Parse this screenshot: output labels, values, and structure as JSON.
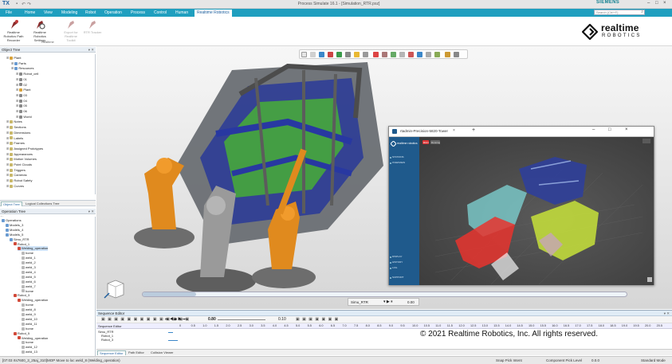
{
  "titlebar": {
    "logo": "TX",
    "app_title": "Process Simulate 16.1 - [Simulation_RTR.psz]",
    "brand": "SIEMENS",
    "win_controls": [
      "–",
      "□",
      "×"
    ]
  },
  "ribbon_tabs": [
    {
      "label": "File",
      "active": false
    },
    {
      "label": "Home",
      "active": false
    },
    {
      "label": "View",
      "active": false
    },
    {
      "label": "Modeling",
      "active": false
    },
    {
      "label": "Robot",
      "active": false
    },
    {
      "label": "Operation",
      "active": false
    },
    {
      "label": "Process",
      "active": false
    },
    {
      "label": "Control",
      "active": false
    },
    {
      "label": "Human",
      "active": false
    },
    {
      "label": "Realtime Robotics",
      "active": true
    }
  ],
  "search": {
    "placeholder": "Search (Ctrl+F)",
    "icon": "search-icon"
  },
  "ribbon": {
    "buttons": [
      {
        "label": "Realtime Robotics Path Recorder",
        "icon": "path-recorder-icon",
        "disabled": false
      },
      {
        "label": "Realtime Robotics Settings",
        "icon": "settings-icon",
        "disabled": false
      },
      {
        "label": "Export for Realtime Toolkit",
        "icon": "export-icon",
        "disabled": true
      },
      {
        "label": "RTR Tracker",
        "icon": "tracker-icon",
        "disabled": true
      }
    ],
    "group_label": "Realtime"
  },
  "brand_logo": {
    "line1": "realtime",
    "line2": "ROBOTICS"
  },
  "object_tree": {
    "title": "Object Tree",
    "column": "Name",
    "rows": [
      {
        "label": "Plant",
        "indent": 1,
        "color": "#d9a23a"
      },
      {
        "label": "Parts",
        "indent": 2,
        "color": "#6a9bd1"
      },
      {
        "label": "Resources",
        "indent": 2,
        "color": "#6a9bd1"
      },
      {
        "label": "Robot_cell",
        "indent": 3,
        "color": "#888888"
      },
      {
        "label": "01",
        "indent": 3,
        "color": "#888888"
      },
      {
        "label": "02",
        "indent": 3,
        "color": "#888888"
      },
      {
        "label": "Plant",
        "indent": 3,
        "color": "#d9a23a"
      },
      {
        "label": "03",
        "indent": 3,
        "color": "#888888"
      },
      {
        "label": "04",
        "indent": 3,
        "color": "#888888"
      },
      {
        "label": "05",
        "indent": 3,
        "color": "#888888"
      },
      {
        "label": "06",
        "indent": 3,
        "color": "#888888"
      },
      {
        "label": "World",
        "indent": 3,
        "color": "#888888"
      },
      {
        "label": "Notes",
        "indent": 1,
        "color": "#c9b86a"
      },
      {
        "label": "Sections",
        "indent": 1,
        "color": "#c9b86a"
      },
      {
        "label": "Dimensions",
        "indent": 1,
        "color": "#c9b86a"
      },
      {
        "label": "Labels",
        "indent": 1,
        "color": "#c9b86a"
      },
      {
        "label": "Frames",
        "indent": 1,
        "color": "#c9b86a"
      },
      {
        "label": "Assigned Prototypes",
        "indent": 1,
        "color": "#c9b86a"
      },
      {
        "label": "Appearances",
        "indent": 1,
        "color": "#c9b86a"
      },
      {
        "label": "Motion Volumes",
        "indent": 1,
        "color": "#c9b86a"
      },
      {
        "label": "Point Clouds",
        "indent": 1,
        "color": "#c9b86a"
      },
      {
        "label": "Triggers",
        "indent": 1,
        "color": "#c9b86a"
      },
      {
        "label": "Cameras",
        "indent": 1,
        "color": "#c9b86a"
      },
      {
        "label": "Robot Safety",
        "indent": 1,
        "color": "#c9b86a"
      },
      {
        "label": "Curves",
        "indent": 1,
        "color": "#c9b86a"
      }
    ],
    "tabs": [
      {
        "label": "Object Tree",
        "active": true
      },
      {
        "label": "Logical Collections Tree",
        "active": false
      }
    ]
  },
  "operation_tree": {
    "title": "Operation Tree",
    "column": "Name",
    "rows": [
      {
        "label": "Operations",
        "indent": 0,
        "selected": false
      },
      {
        "label": "Models_3",
        "indent": 1,
        "selected": false
      },
      {
        "label": "Models_4",
        "indent": 1,
        "selected": false
      },
      {
        "label": "Models_5",
        "indent": 1,
        "selected": false
      },
      {
        "label": "Simu_RTR",
        "indent": 2,
        "selected": false
      },
      {
        "label": "Robot_1",
        "indent": 3,
        "selected": false
      },
      {
        "label": "Welding_operation",
        "indent": 4,
        "selected": true
      },
      {
        "label": "home",
        "indent": 5,
        "selected": false
      },
      {
        "label": "weld_1",
        "indent": 5,
        "selected": false
      },
      {
        "label": "weld_2",
        "indent": 5,
        "selected": false
      },
      {
        "label": "weld_3",
        "indent": 5,
        "selected": false
      },
      {
        "label": "weld_4",
        "indent": 5,
        "selected": false
      },
      {
        "label": "weld_5",
        "indent": 5,
        "selected": false
      },
      {
        "label": "weld_6",
        "indent": 5,
        "selected": false
      },
      {
        "label": "weld_7",
        "indent": 5,
        "selected": false
      },
      {
        "label": "home",
        "indent": 5,
        "selected": false
      },
      {
        "label": "Robot_3",
        "indent": 3,
        "selected": false
      },
      {
        "label": "Welding_operation",
        "indent": 4,
        "selected": false
      },
      {
        "label": "home",
        "indent": 5,
        "selected": false
      },
      {
        "label": "weld_8",
        "indent": 5,
        "selected": false
      },
      {
        "label": "weld_9",
        "indent": 5,
        "selected": false
      },
      {
        "label": "weld_10",
        "indent": 5,
        "selected": false
      },
      {
        "label": "weld_11",
        "indent": 5,
        "selected": false
      },
      {
        "label": "home",
        "indent": 5,
        "selected": false
      },
      {
        "label": "Robot_5",
        "indent": 3,
        "selected": false
      },
      {
        "label": "Welding_operation",
        "indent": 4,
        "selected": false
      },
      {
        "label": "home",
        "indent": 5,
        "selected": false
      },
      {
        "label": "weld_12",
        "indent": 5,
        "selected": false
      },
      {
        "label": "weld_13",
        "indent": 5,
        "selected": false
      }
    ]
  },
  "embedded_window": {
    "tab_title": "rtadmin-Precision-5820-Tower",
    "sidebar_brand": "realtime robotics",
    "sidebar_items": [
      "STATIONS",
      "OVERVIEW",
      "DISPLAY",
      "HISTORY",
      "LOG",
      "SUPPORT"
    ],
    "status_pill": "RUN",
    "status_mode": "Running"
  },
  "timeline": {
    "progress": 0.11
  },
  "study_selector": {
    "value": "Simu_RTR",
    "time_value": "0.00"
  },
  "sequence_editor": {
    "title": "Sequence Editor",
    "column": "Sequence Editor",
    "speed_value": "0.80",
    "step_value": "0.10",
    "ticks": [
      "0",
      "0.5",
      "1.0",
      "1.5",
      "2.0",
      "2.5",
      "3.0",
      "3.5",
      "4.0",
      "4.5",
      "5.0",
      "5.5",
      "6.0",
      "6.5",
      "7.0",
      "7.5",
      "8.0",
      "8.5",
      "9.0",
      "9.5",
      "10.0",
      "10.5",
      "11.0",
      "11.5",
      "12.0",
      "12.5",
      "13.0",
      "13.5",
      "14.0",
      "14.5",
      "15.0",
      "15.5",
      "16.0",
      "16.5",
      "17.0",
      "17.5",
      "18.0",
      "18.5",
      "19.0",
      "19.5",
      "20.0",
      "20.5"
    ],
    "rows": [
      "Simu_RTR",
      "Robot_1",
      "Robot_3"
    ],
    "tabs": [
      {
        "label": "Sequence Editor",
        "active": true
      },
      {
        "label": "Path Editor",
        "active": false
      },
      {
        "label": "Collision Viewer",
        "active": false
      }
    ],
    "copyright": "© 2021 Realtime Robotics, Inc. All rights reserved."
  },
  "statusbar": {
    "message": "[07:03 rts7600_3_25aj_310]MOP Move to loc weld_8 (Welding_operation)",
    "snap": "Snap Pick Intent",
    "component": "Component Pick Level",
    "coords": "0.0.0",
    "mode": "Standard Mode"
  }
}
